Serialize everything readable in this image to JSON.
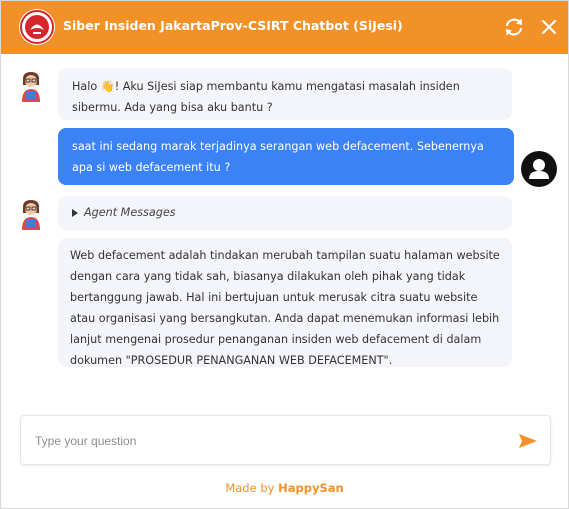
{
  "header": {
    "title": "Siber Insiden JakartaProv-CSIRT Chatbot (SiJesi)",
    "logo_icon": "csirt-logo-icon",
    "refresh_icon": "refresh-icon",
    "close_icon": "close-icon",
    "bg_color": "#f39129"
  },
  "messages": [
    {
      "sender": "bot",
      "text": "Halo 👋! Aku SiJesi siap membantu kamu mengatasi masalah insiden sibermu. Ada yang bisa aku bantu ?"
    },
    {
      "sender": "user",
      "text": "saat ini sedang marak terjadinya serangan web defacement. Sebenernya apa si web defacement itu ?"
    },
    {
      "sender": "bot",
      "text": "Agent Messages",
      "kind": "collapsible"
    },
    {
      "sender": "bot",
      "text": "Web defacement adalah tindakan merubah tampilan suatu halaman website dengan cara yang tidak sah, biasanya dilakukan oleh pihak yang tidak bertanggung jawab. Hal ini bertujuan untuk merusak citra suatu website atau organisasi yang bersangkutan. Anda dapat menemukan informasi lebih lanjut mengenai prosedur penanganan insiden web defacement di dalam dokumen \"PROSEDUR PENANGANAN WEB DEFACEMENT\"."
    }
  ],
  "input": {
    "placeholder": "Type your question",
    "value": "",
    "send_icon": "send-icon"
  },
  "footer": {
    "prefix": "Made by ",
    "brand": "HappySan"
  },
  "colors": {
    "accent": "#f39129",
    "user_bubble": "#3b82f6",
    "bot_bubble": "#f4f5fa"
  }
}
